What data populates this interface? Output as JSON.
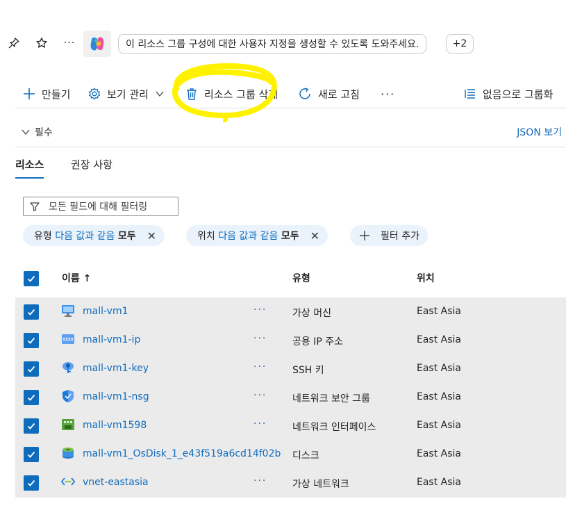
{
  "copilot": {
    "prompt": "이 리소스 그룹 구성에 대한 사용자 지정을 생성할 수 있도록 도와주세요.",
    "more_count": "+2"
  },
  "commands": {
    "create": "만들기",
    "manage_view": "보기 관리",
    "delete_group": "리소스 그룹 삭제",
    "refresh": "새로 고침",
    "more": "···",
    "group_by": "없음으로 그룹화"
  },
  "essentials": {
    "label": "필수",
    "json_view": "JSON 보기"
  },
  "tabs": [
    {
      "label": "리소스",
      "active": true
    },
    {
      "label": "권장 사항",
      "active": false
    }
  ],
  "filter": {
    "placeholder": "모든 필드에 대해 필터링",
    "chips": [
      {
        "field": "유형",
        "op": "다음 값과 같음",
        "value": "모두"
      },
      {
        "field": "위치",
        "op": "다음 값과 같음",
        "value": "모두"
      }
    ],
    "add_filter": "필터 추가"
  },
  "table": {
    "headers": {
      "name": "이름 ↑",
      "type": "유형",
      "location": "위치"
    },
    "rows": [
      {
        "name": "mall-vm1",
        "type": "가상 머신",
        "location": "East Asia",
        "icon": "vm-icon",
        "has_more": true
      },
      {
        "name": "mall-vm1-ip",
        "type": "공용 IP 주소",
        "location": "East Asia",
        "icon": "public-ip-icon",
        "has_more": true
      },
      {
        "name": "mall-vm1-key",
        "type": "SSH 키",
        "location": "East Asia",
        "icon": "ssh-key-icon",
        "has_more": true
      },
      {
        "name": "mall-vm1-nsg",
        "type": "네트워크 보안 그룹",
        "location": "East Asia",
        "icon": "nsg-shield-icon",
        "has_more": true
      },
      {
        "name": "mall-vm1598",
        "type": "네트워크 인터페이스",
        "location": "East Asia",
        "icon": "nic-icon",
        "has_more": true
      },
      {
        "name": "mall-vm1_OsDisk_1_e43f519a6cd14f02b",
        "type": "디스크",
        "location": "East Asia",
        "icon": "disk-icon",
        "has_more": false
      },
      {
        "name": "vnet-eastasia",
        "type": "가상 네트워크",
        "location": "East Asia",
        "icon": "vnet-icon",
        "has_more": true
      }
    ]
  },
  "colors": {
    "accent": "#0f6cbd",
    "highlight_scribble": "#fff200",
    "row_selected_bg": "#ebebeb"
  }
}
